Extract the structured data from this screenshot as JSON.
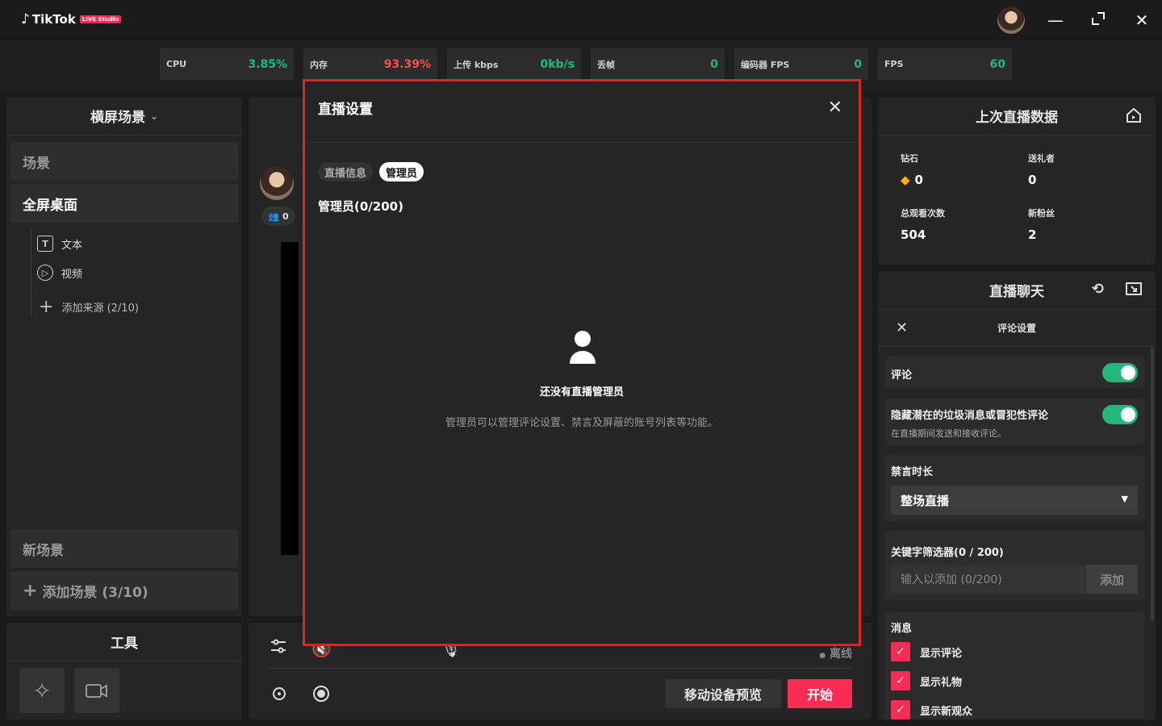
{
  "app": {
    "logo_text": "TikTok",
    "logo_badge": "LIVE Studio",
    "colors": {
      "accent": "#fe2c55",
      "green": "#23b77c",
      "red": "#e02424"
    }
  },
  "stats": [
    {
      "label": "CPU",
      "value": "3.85%",
      "color": "#23b77c"
    },
    {
      "label": "内存",
      "value": "93.39%",
      "color": "#fe4d4d"
    },
    {
      "label": "上传 kbps",
      "value": "0kb/s",
      "color": "#23b77c"
    },
    {
      "label": "丢帧",
      "value": "0",
      "color": "#23b77c"
    },
    {
      "label": "编码器 FPS",
      "value": "0",
      "color": "#23b77c"
    },
    {
      "label": "FPS",
      "value": "60",
      "color": "#23b77c"
    }
  ],
  "scene_panel": {
    "header": "横屏场景",
    "scenes": [
      "场景",
      "全屏桌面"
    ],
    "sources": [
      "文本",
      "视频"
    ],
    "add_source": "添加来源 (2/10)",
    "new_scene": "新场景",
    "add_scene": "添加场景 (3/10)"
  },
  "tools": {
    "header": "工具"
  },
  "middle": {
    "viewer_count": "0",
    "offline": "离线",
    "preview_button": "移动设备预览",
    "start_button": "开始"
  },
  "last_live": {
    "header": "上次直播数据",
    "diamonds_label": "钻石",
    "diamonds_value": "0",
    "gifters_label": "送礼者",
    "gifters_value": "0",
    "views_label": "总观看次数",
    "views_value": "504",
    "followers_label": "新粉丝",
    "followers_value": "2"
  },
  "chat": {
    "header": "直播聊天",
    "comment_settings": "评论设置",
    "comments_label": "评论",
    "hide_spam_label": "隐藏潜在的垃圾消息或冒犯性评论",
    "hide_spam_sub": "在直播期间发送和接收评论。",
    "mute_duration_label": "禁言时长",
    "mute_duration_value": "整场直播",
    "keyword_label": "关键字筛选器(0 / 200)",
    "keyword_placeholder": "输入以添加 (0/200)",
    "keyword_add": "添加",
    "messages_label": "消息",
    "show_comments": "显示评论",
    "show_gifts": "显示礼物",
    "show_new_viewers": "显示新观众"
  },
  "modal": {
    "title": "直播设置",
    "tab_info": "直播信息",
    "tab_admin": "管理员",
    "admin_count": "管理员(0/200)",
    "empty_title": "还没有直播管理员",
    "empty_desc": "管理员可以管理评论设置、禁言及屏蔽的账号列表等功能。"
  }
}
